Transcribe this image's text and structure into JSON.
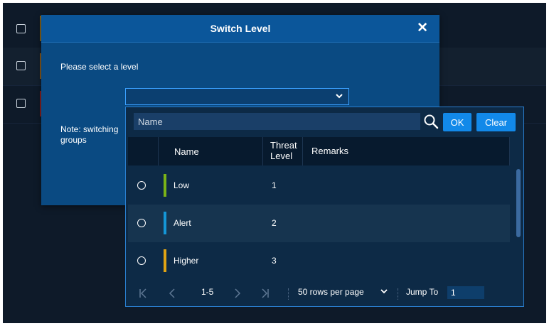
{
  "background_rows": [
    {
      "bar_color": "#8a6418"
    },
    {
      "bar_color": "#8a5a1a"
    },
    {
      "bar_color": "#8a1f1f"
    }
  ],
  "dialog": {
    "title": "Switch Level",
    "close_icon": "close-icon",
    "prompt": "Please select a level",
    "note_line1": "Note: switching",
    "note_line2": "groups"
  },
  "select": {
    "value": "",
    "chevron_icon": "chevron-down-icon"
  },
  "dropdown": {
    "search_placeholder": "Name",
    "search_icon": "search-icon",
    "ok_label": "OK",
    "clear_label": "Clear",
    "columns": {
      "name": "Name",
      "threat_line1": "Threat",
      "threat_line2": "Level",
      "remarks": "Remarks"
    },
    "rows": [
      {
        "name": "Low",
        "threat_level": "1",
        "remarks": "",
        "color": "#7ab317",
        "selected": false
      },
      {
        "name": "Alert",
        "threat_level": "2",
        "remarks": "",
        "color": "#1496d6",
        "selected": false
      },
      {
        "name": "Higher",
        "threat_level": "3",
        "remarks": "",
        "color": "#e0a414",
        "selected": false
      }
    ]
  },
  "pagination": {
    "first_icon": "first-page-icon",
    "prev_icon": "prev-page-icon",
    "next_icon": "next-page-icon",
    "last_icon": "last-page-icon",
    "range": "1-5",
    "rows_per_page": "50 rows per page",
    "jump_label": "Jump To",
    "jump_value": "1"
  },
  "colors": {
    "accent": "#1289e9",
    "dialog_bg": "#0a4a82",
    "page_bg": "#0e1a29"
  }
}
